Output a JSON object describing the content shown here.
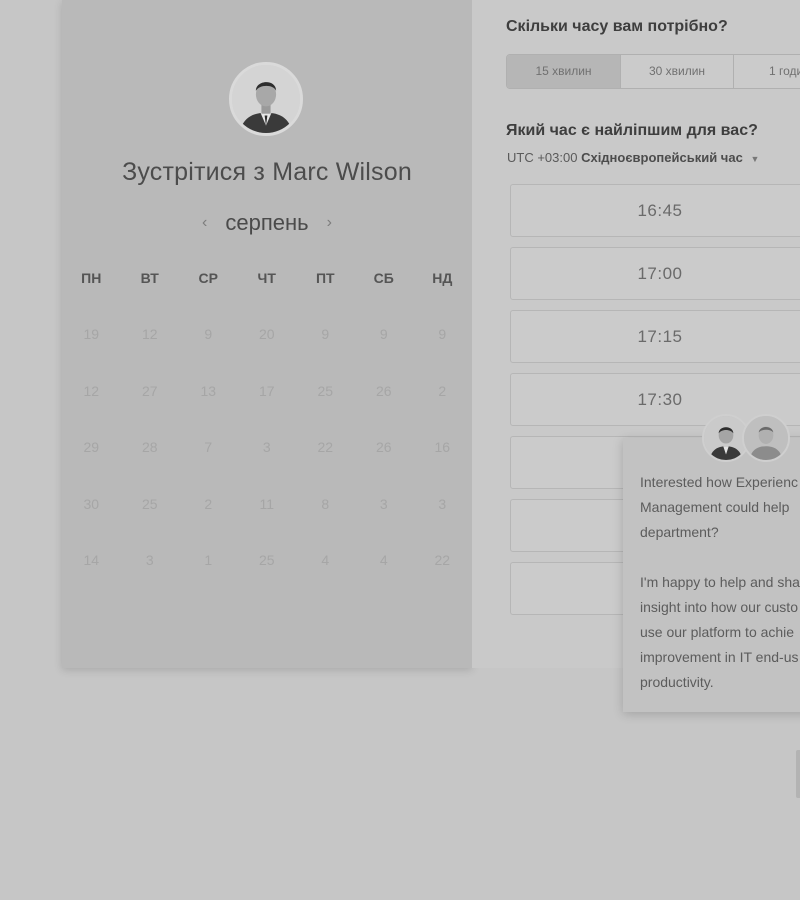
{
  "host": {
    "meet_prefix": "Зустрітися з",
    "name": "Marc Wilson"
  },
  "calendar": {
    "month": "серпень",
    "prev_icon": "chevron-left-icon",
    "next_icon": "chevron-right-icon",
    "weekdays": [
      "ПН",
      "ВТ",
      "СР",
      "ЧТ",
      "ПТ",
      "СБ",
      "НД"
    ],
    "weeks": [
      [
        "19",
        "12",
        "9",
        "20",
        "9",
        "9",
        "9"
      ],
      [
        "12",
        "27",
        "13",
        "17",
        "25",
        "26",
        "2"
      ],
      [
        "29",
        "28",
        "7",
        "3",
        "22",
        "26",
        "16"
      ],
      [
        "30",
        "25",
        "2",
        "11",
        "8",
        "3",
        "3"
      ],
      [
        "14",
        "3",
        "1",
        "25",
        "4",
        "4",
        "22"
      ]
    ]
  },
  "duration": {
    "question": "Скільки часу вам потрібно?",
    "options": [
      "15 хвилин",
      "30 хвилин",
      "1 годи"
    ],
    "selected": "15 хвилин"
  },
  "time": {
    "question": "Який час є найліпшим для вас?",
    "tz_offset": "UTC +03:00",
    "tz_name": "Східноєвропейський час",
    "slots": [
      "16:45",
      "17:00",
      "17:15",
      "17:30",
      "",
      "",
      "",
      ""
    ]
  },
  "chat": {
    "message": "Interested how Experienc\nManagement could help\ndepartment?\n\nI'm happy to help and sha\ninsight into how our custo\nuse our platform to achie\nimprovement in IT end-us\nproductivity."
  }
}
